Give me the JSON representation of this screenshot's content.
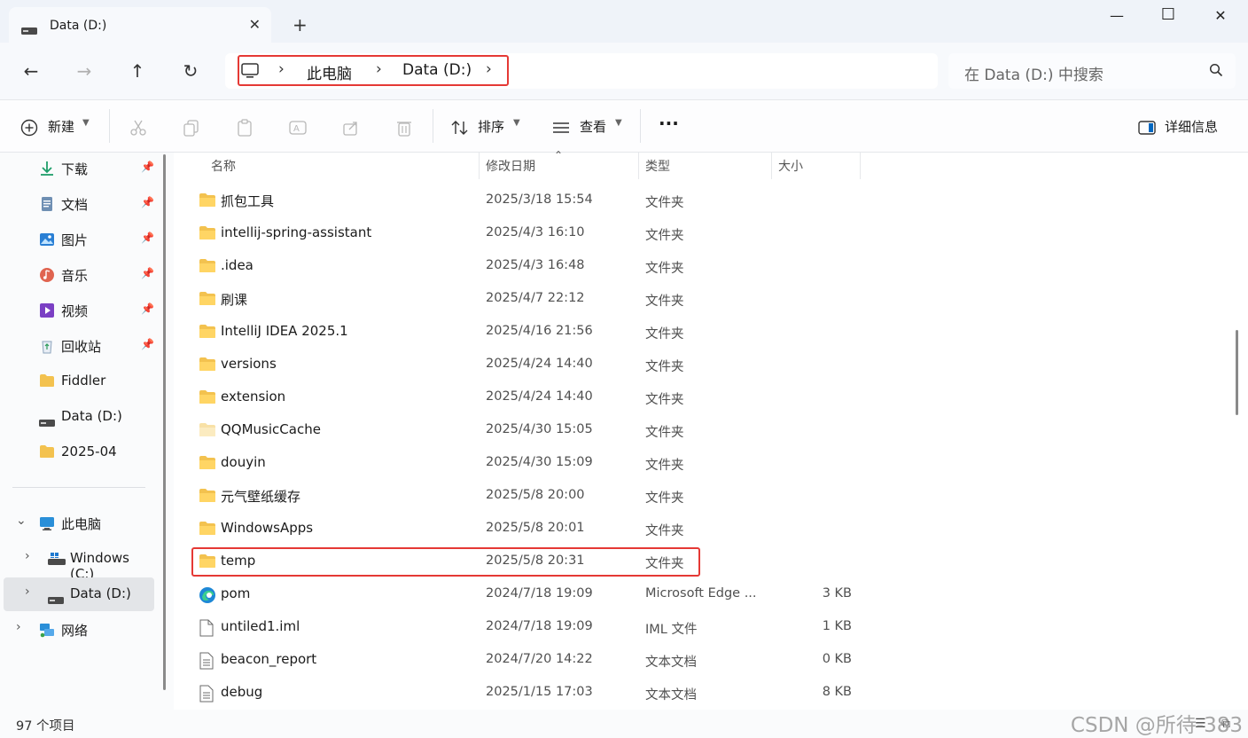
{
  "window": {
    "tab_title": "Data (D:)",
    "tab_close": "✕",
    "new_tab": "+",
    "minimize": "—",
    "maximize": "☐",
    "close": "✕"
  },
  "nav": {
    "back": "←",
    "forward": "→",
    "up": "↑",
    "refresh": "↻"
  },
  "address": {
    "sep": "›",
    "crumbs": [
      "此电脑",
      "Data (D:)"
    ]
  },
  "search": {
    "placeholder": "在 Data (D:) 中搜索"
  },
  "commandbar": {
    "new_label": "新建",
    "sort_label": "排序",
    "view_label": "查看",
    "more_label": "···",
    "details_label": "详细信息"
  },
  "sidebar": {
    "quick": [
      {
        "label": "下载",
        "icon": "download-icon",
        "pinned": true
      },
      {
        "label": "文档",
        "icon": "document-icon",
        "pinned": true
      },
      {
        "label": "图片",
        "icon": "pictures-icon",
        "pinned": true
      },
      {
        "label": "音乐",
        "icon": "music-icon",
        "pinned": true
      },
      {
        "label": "视频",
        "icon": "video-icon",
        "pinned": true
      },
      {
        "label": "回收站",
        "icon": "recycle-bin-icon",
        "pinned": true
      },
      {
        "label": "Fiddler",
        "icon": "folder-icon",
        "pinned": false
      },
      {
        "label": "Data (D:)",
        "icon": "drive-icon",
        "pinned": false
      },
      {
        "label": "2025-04",
        "icon": "folder-icon",
        "pinned": false
      }
    ],
    "tree": [
      {
        "label": "此电脑",
        "icon": "this-pc-icon",
        "expanded": true
      },
      {
        "label": "Windows (C:)",
        "icon": "windows-drive-icon",
        "expanded": false
      },
      {
        "label": "Data (D:)",
        "icon": "drive-icon",
        "expanded": false,
        "selected": true
      },
      {
        "label": "网络",
        "icon": "network-icon",
        "expanded": false
      }
    ]
  },
  "columns": {
    "name": "名称",
    "date": "修改日期",
    "type": "类型",
    "size": "大小"
  },
  "files": [
    {
      "name": "抓包工具",
      "date": "2025/3/18 15:54",
      "type": "文件夹",
      "size": "",
      "icon": "folder-icon"
    },
    {
      "name": "intellij-spring-assistant",
      "date": "2025/4/3 16:10",
      "type": "文件夹",
      "size": "",
      "icon": "folder-icon"
    },
    {
      "name": ".idea",
      "date": "2025/4/3 16:48",
      "type": "文件夹",
      "size": "",
      "icon": "folder-icon"
    },
    {
      "name": "刷课",
      "date": "2025/4/7 22:12",
      "type": "文件夹",
      "size": "",
      "icon": "folder-icon"
    },
    {
      "name": "IntelliJ IDEA 2025.1",
      "date": "2025/4/16 21:56",
      "type": "文件夹",
      "size": "",
      "icon": "folder-icon"
    },
    {
      "name": "versions",
      "date": "2025/4/24 14:40",
      "type": "文件夹",
      "size": "",
      "icon": "folder-icon"
    },
    {
      "name": "extension",
      "date": "2025/4/24 14:40",
      "type": "文件夹",
      "size": "",
      "icon": "folder-icon"
    },
    {
      "name": "QQMusicCache",
      "date": "2025/4/30 15:05",
      "type": "文件夹",
      "size": "",
      "icon": "hidden-folder-icon"
    },
    {
      "name": "douyin",
      "date": "2025/4/30 15:09",
      "type": "文件夹",
      "size": "",
      "icon": "folder-icon"
    },
    {
      "name": "元气壁纸缓存",
      "date": "2025/5/8 20:00",
      "type": "文件夹",
      "size": "",
      "icon": "folder-icon"
    },
    {
      "name": "WindowsApps",
      "date": "2025/5/8 20:01",
      "type": "文件夹",
      "size": "",
      "icon": "folder-icon"
    },
    {
      "name": "temp",
      "date": "2025/5/8 20:31",
      "type": "文件夹",
      "size": "",
      "icon": "folder-icon",
      "highlighted": true
    },
    {
      "name": "pom",
      "date": "2024/7/18 19:09",
      "type": "Microsoft Edge ...",
      "size": "3 KB",
      "icon": "edge-icon"
    },
    {
      "name": "untiled1.iml",
      "date": "2024/7/18 19:09",
      "type": "IML 文件",
      "size": "1 KB",
      "icon": "file-icon"
    },
    {
      "name": "beacon_report",
      "date": "2024/7/20 14:22",
      "type": "文本文档",
      "size": "0 KB",
      "icon": "text-file-icon"
    },
    {
      "name": "debug",
      "date": "2025/1/15 17:03",
      "type": "文本文档",
      "size": "8 KB",
      "icon": "text-file-icon"
    }
  ],
  "status": {
    "count": "97 个项目",
    "watermark": "CSDN @所待-383"
  },
  "colors": {
    "highlight_border": "#e53935",
    "folder": "#f3c24f",
    "accent": "#0067c0"
  }
}
